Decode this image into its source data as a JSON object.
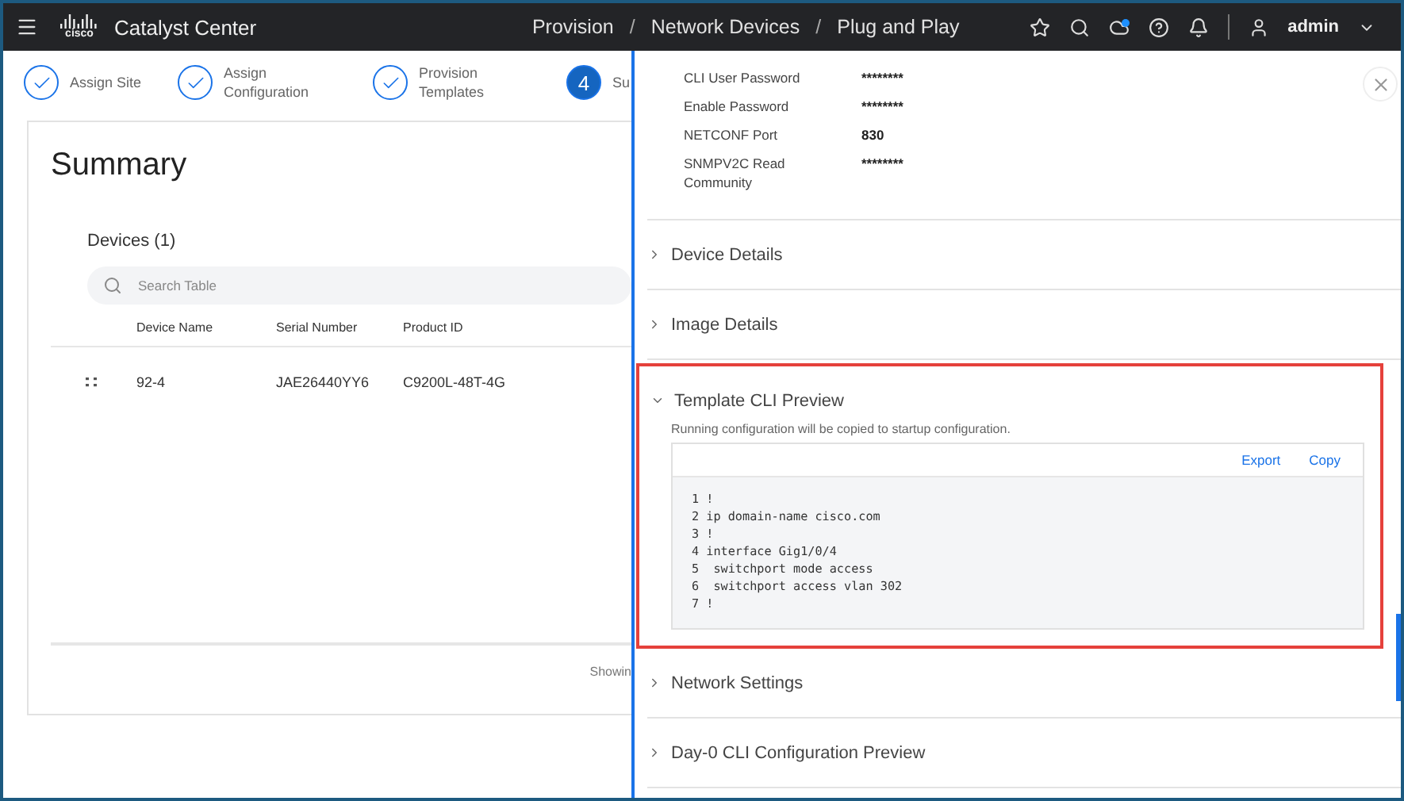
{
  "header": {
    "logo_text": "cisco",
    "app_title": "Catalyst Center",
    "breadcrumb": [
      {
        "kind": "link",
        "text": "Provision"
      },
      {
        "kind": "separator",
        "text": "/"
      },
      {
        "kind": "link",
        "text": "Network Devices"
      },
      {
        "kind": "separator",
        "text": "/"
      },
      {
        "kind": "link",
        "text": "Plug and Play"
      }
    ],
    "user": "admin"
  },
  "steps": [
    {
      "label": "Assign Site",
      "done": true
    },
    {
      "label": "Assign Configuration",
      "done": true
    },
    {
      "label": "Provision Templates",
      "done": true
    },
    {
      "number": "4",
      "label": "Su",
      "done": false
    }
  ],
  "summary": {
    "title": "Summary",
    "devices_title": "Devices (1)",
    "search": {
      "placeholder": "Search Table"
    },
    "columns": [
      "",
      "Device Name",
      "Serial Number",
      "Product ID"
    ],
    "rows": [
      {
        "cells": [
          "",
          "92-4",
          "JAE26440YY6",
          "C9200L-48T-4G"
        ]
      }
    ],
    "footer": "Showin"
  },
  "drawer": {
    "credentials": [
      {
        "label": "CLI User Password",
        "value": "********"
      },
      {
        "label": "Enable Password",
        "value": "********"
      },
      {
        "label": "NETCONF Port",
        "value": "830"
      },
      {
        "label": "SNMPV2C Read Community",
        "value": "********"
      }
    ],
    "sections": [
      {
        "title": "Device Details",
        "expanded": false,
        "highlighted": false
      },
      {
        "title": "Image Details",
        "expanded": false,
        "highlighted": false
      },
      {
        "title": "Template CLI Preview",
        "expanded": true,
        "highlighted": true,
        "note": "Running configuration will be copied to startup configuration.",
        "actions": [
          "Export",
          "Copy"
        ],
        "code": [
          {
            "number": "1",
            "text": "!"
          },
          {
            "number": "2",
            "text": "ip domain-name cisco.com"
          },
          {
            "number": "3",
            "text": "!"
          },
          {
            "number": "4",
            "text": "interface Gig1/0/4"
          },
          {
            "number": "5",
            "text": " switchport mode access"
          },
          {
            "number": "6",
            "text": " switchport access vlan 302"
          },
          {
            "number": "7",
            "text": "!"
          }
        ]
      },
      {
        "title": "Network Settings",
        "expanded": false,
        "highlighted": false
      },
      {
        "title": "Day-0 CLI Configuration Preview",
        "expanded": false,
        "highlighted": false
      }
    ]
  }
}
